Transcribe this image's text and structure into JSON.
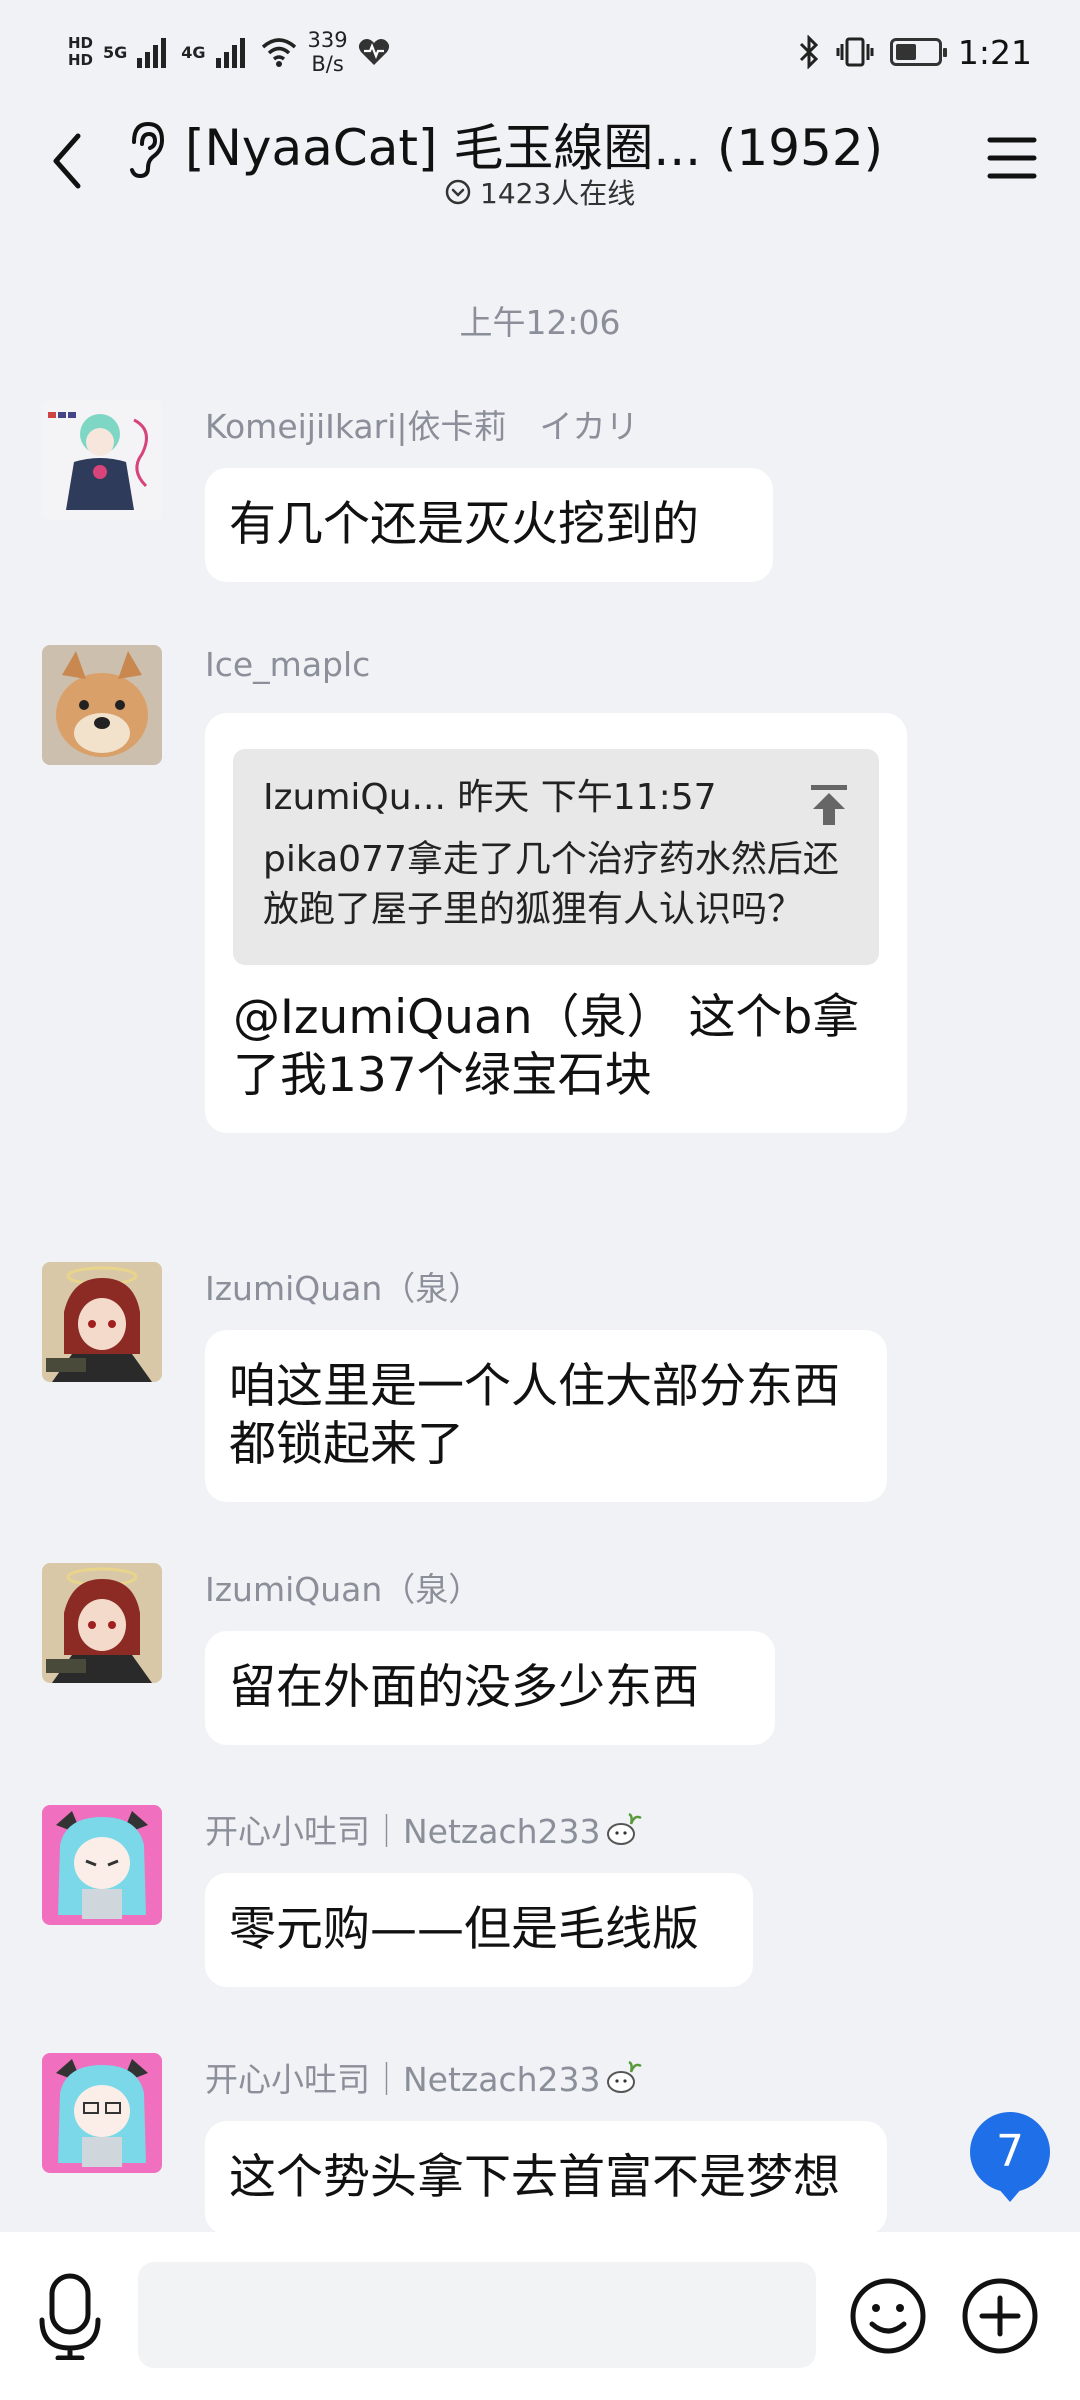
{
  "status_bar": {
    "hd1": "HD",
    "hd2": "HD",
    "net1": "5G",
    "net2": "4G",
    "speed_value": "339",
    "speed_unit": "B/s",
    "time": "1:21",
    "battery_level": 0.5
  },
  "header": {
    "title": "[NyaaCat] 毛玉線圈... (1952)",
    "online": "1423人在线"
  },
  "timestamp": "上午12:06",
  "messages": [
    {
      "sender": "KomeijiIkari|依卡莉　イカリ",
      "text": "有几个还是灭火挖到的"
    },
    {
      "sender": "Ice_maplc",
      "quote_header": "IzumiQu... 昨天 下午11:57",
      "quote_text": "pika077拿走了几个治疗药水然后还放跑了屋子里的狐狸有人认识吗？",
      "text": "@IzumiQuan（泉） 这个b拿了我137个绿宝石块"
    },
    {
      "sender": "IzumiQuan（泉）",
      "text": "咱这里是一个人住大部分东西都锁起来了"
    },
    {
      "sender": "IzumiQuan（泉）",
      "text": "留在外面的没多少东西"
    },
    {
      "sender": "开心小吐司｜Netzach233",
      "text": "零元购——但是毛线版"
    },
    {
      "sender": "开心小吐司｜Netzach233",
      "text": "这个势头拿下去首富不是梦想"
    }
  ],
  "unread_count": "7",
  "input": {
    "placeholder": ""
  },
  "icons": {
    "back": "chevron-left-icon",
    "ear": "ear-icon",
    "menu": "hamburger-menu-icon",
    "mic": "microphone-icon",
    "emoji": "smiley-icon",
    "plus": "plus-circle-icon"
  }
}
